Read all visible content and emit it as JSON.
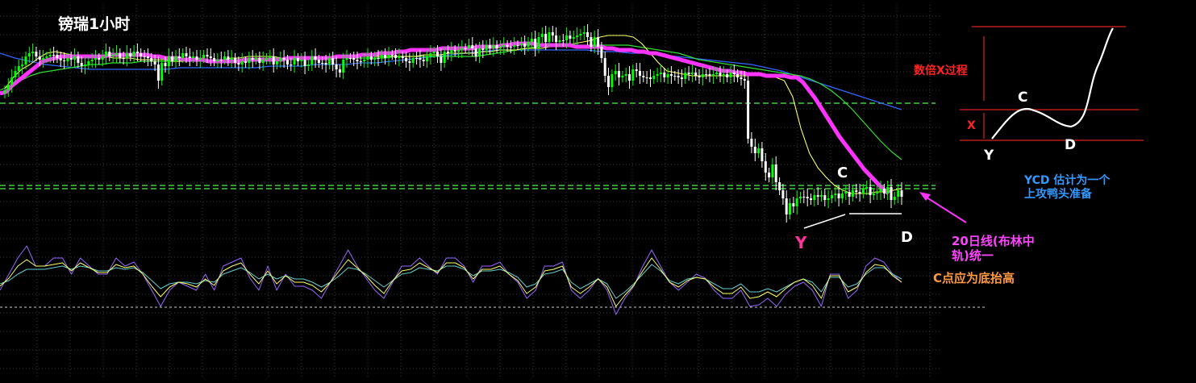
{
  "chart_data": {
    "type": "line",
    "title": "镑瑞1小时",
    "xlabel": "",
    "ylabel": "",
    "grid": true,
    "colors": {
      "background": "#000000",
      "bull": "#00ff00",
      "bear": "#ffffff",
      "ma_main": "#ff33ff",
      "ma_fast": "#ffff66",
      "ma_green": "#33dd33",
      "ma_blue": "#3366ff",
      "support": "#44cc44",
      "grid": "#4a4a4a",
      "osc_purple": "#9966ff",
      "osc_yellow": "#ffff66",
      "osc_cyan": "#66cccc"
    },
    "price": {
      "closes": [
        112,
        105,
        96,
        88,
        82,
        80,
        70,
        66,
        64,
        70,
        74,
        72,
        70,
        68,
        68,
        72,
        75,
        76,
        72,
        74,
        70,
        78,
        82,
        80,
        76,
        74,
        72,
        74,
        70,
        64,
        70,
        68,
        66,
        72,
        72,
        66,
        70,
        64,
        66,
        70,
        70,
        72,
        76,
        80,
        100,
        78,
        82,
        70,
        76,
        70,
        72,
        66,
        70,
        72,
        70,
        74,
        72,
        68,
        70,
        72,
        76,
        74,
        74,
        70,
        74,
        72,
        78,
        80,
        76,
        78,
        72,
        74,
        72,
        78,
        74,
        72,
        70,
        80,
        76,
        72,
        74,
        80,
        80,
        72,
        76,
        74,
        82,
        80,
        70,
        74,
        78,
        78,
        80,
        72,
        80,
        86,
        90,
        74,
        72,
        72,
        74,
        76,
        76,
        74,
        70,
        74,
        72,
        72,
        68,
        72,
        68,
        68,
        72,
        70,
        72,
        76,
        78,
        72,
        72,
        74,
        76,
        70,
        66,
        64,
        70,
        78,
        64,
        66,
        62,
        64,
        62,
        60,
        60,
        56,
        60,
        70,
        60,
        62,
        56,
        60,
        56,
        60,
        58,
        56,
        58,
        58,
        56,
        56,
        54,
        58,
        52,
        48,
        60,
        46,
        42,
        52,
        40,
        44,
        52,
        50,
        50,
        44,
        48,
        46,
        44,
        42,
        40,
        46,
        58,
        46,
        58,
        72,
        94,
        108,
        92,
        88,
        96,
        94,
        92,
        100,
        86,
        88,
        94,
        96,
        96,
        98,
        94,
        92,
        90,
        96,
        92,
        94,
        94,
        96,
        98,
        90,
        92,
        90,
        94,
        96,
        92,
        92,
        94,
        92,
        90,
        94,
        92,
        96,
        90,
        92,
        96,
        98,
        100,
        172,
        182,
        190,
        184,
        200,
        214,
        220,
        204,
        226,
        236,
        246,
        266,
        252,
        256,
        246,
        244,
        244,
        246,
        248,
        242,
        244,
        242,
        248,
        246,
        242,
        240,
        246,
        240,
        238,
        244,
        236,
        238,
        240,
        234,
        232,
        242,
        240,
        238,
        234,
        240,
        232,
        248,
        244,
        236,
        244
      ],
      "wick_range": 6,
      "ma_main": [
        116,
        114,
        106,
        100,
        94,
        88,
        82,
        76,
        74,
        72,
        70,
        70,
        70,
        70,
        70,
        70,
        70,
        70,
        68,
        68,
        68,
        68,
        68,
        68,
        68,
        70,
        70,
        72,
        72,
        72,
        74,
        74,
        74,
        74,
        76,
        76,
        76,
        76,
        76,
        76,
        74,
        74,
        74,
        74,
        74,
        74,
        74,
        72,
        72,
        72,
        72,
        72,
        72,
        72,
        72,
        70,
        70,
        70,
        70,
        68,
        68,
        68,
        66,
        66,
        66,
        64,
        64,
        62,
        62,
        62,
        62,
        62,
        60,
        60,
        60,
        60,
        60,
        60,
        58,
        58,
        58,
        58,
        56,
        56,
        54,
        54,
        54,
        54,
        56,
        56,
        56,
        56,
        56,
        56,
        58,
        58,
        58,
        58,
        58,
        60,
        60,
        62,
        62,
        62,
        64,
        64,
        66,
        66,
        68,
        70,
        72,
        74,
        76,
        78,
        80,
        82,
        84,
        86,
        88,
        88,
        90,
        90,
        92,
        92,
        92,
        94,
        94,
        94,
        94,
        96,
        96,
        102,
        112,
        122,
        134,
        146,
        158,
        170,
        180,
        190,
        200,
        210,
        218,
        226,
        234,
        240
      ],
      "ma_fast": [
        110,
        96,
        86,
        80,
        72,
        66,
        64,
        66,
        68,
        68,
        70,
        70,
        70,
        72,
        72,
        72,
        74,
        74,
        74,
        74,
        76,
        76,
        76,
        76,
        76,
        74,
        74,
        72,
        72,
        70,
        70,
        70,
        70,
        72,
        72,
        74,
        72,
        72,
        72,
        72,
        72,
        70,
        70,
        70,
        70,
        70,
        70,
        70,
        70,
        70,
        68,
        68,
        68,
        66,
        66,
        66,
        66,
        64,
        64,
        62,
        62,
        62,
        60,
        60,
        60,
        58,
        58,
        56,
        54,
        52,
        50,
        46,
        44,
        44,
        44,
        46,
        54,
        66,
        78,
        88,
        90,
        92,
        94,
        94,
        94,
        94,
        94,
        94,
        94,
        94,
        94,
        94,
        96,
        100,
        120,
        160,
        190,
        208,
        220,
        230,
        236,
        240,
        240,
        240,
        238,
        238,
        236,
        234
      ],
      "ma_green": [
        112,
        106,
        100,
        94,
        90,
        88,
        86,
        84,
        82,
        80,
        80,
        78,
        78,
        78,
        76,
        76,
        76,
        76,
        76,
        76,
        76,
        76,
        76,
        76,
        74,
        74,
        74,
        74,
        74,
        72,
        72,
        72,
        72,
        72,
        72,
        72,
        72,
        72,
        72,
        70,
        70,
        70,
        70,
        70,
        70,
        70,
        70,
        70,
        68,
        66,
        64,
        62,
        60,
        58,
        56,
        56,
        56,
        56,
        56,
        56,
        56,
        56,
        56,
        58,
        60,
        62,
        64,
        66,
        70,
        74,
        76,
        78,
        80,
        82,
        84,
        86,
        88,
        90,
        92,
        94,
        98,
        104,
        112,
        122,
        134,
        148,
        162,
        176,
        188,
        198
      ],
      "ma_blue": [
        66,
        72,
        76,
        80,
        82,
        84,
        86,
        86,
        86,
        86,
        86,
        86,
        84,
        84,
        84,
        84,
        84,
        84,
        82,
        82,
        82,
        80,
        80,
        80,
        78,
        78,
        76,
        74,
        72,
        70,
        68,
        66,
        64,
        62,
        62,
        62,
        62,
        62,
        62,
        62,
        64,
        64,
        66,
        66,
        68,
        70,
        72,
        74,
        76,
        78,
        80,
        84,
        88,
        94,
        100,
        106,
        112,
        118,
        124,
        130,
        136
      ]
    },
    "support_levels": [
      128,
      230,
      234
    ],
    "oscillator": {
      "purple": [
        360,
        340,
        320,
        305,
        330,
        330,
        320,
        320,
        340,
        320,
        330,
        340,
        340,
        320,
        330,
        325,
        340,
        360,
        380,
        360,
        350,
        355,
        360,
        340,
        360,
        330,
        325,
        320,
        345,
        360,
        330,
        360,
        340,
        355,
        355,
        360,
        370,
        350,
        330,
        310,
        330,
        345,
        360,
        370,
        350,
        330,
        330,
        320,
        330,
        340,
        320,
        320,
        330,
        350,
        330,
        330,
        325,
        340,
        350,
        370,
        360,
        330,
        330,
        325,
        360,
        370,
        360,
        345,
        360,
        390,
        370,
        355,
        330,
        310,
        330,
        350,
        360,
        350,
        340,
        345,
        360,
        370,
        370,
        360,
        380,
        378,
        370,
        380,
        365,
        355,
        350,
        360,
        380,
        340,
        340,
        370,
        360,
        330,
        320,
        325,
        340,
        350
      ],
      "yellow": [
        355,
        345,
        330,
        322,
        330,
        330,
        328,
        326,
        336,
        326,
        332,
        338,
        338,
        328,
        332,
        330,
        340,
        355,
        368,
        356,
        350,
        352,
        356,
        346,
        354,
        336,
        330,
        326,
        340,
        352,
        336,
        352,
        342,
        350,
        350,
        354,
        362,
        350,
        336,
        322,
        332,
        342,
        354,
        364,
        348,
        336,
        334,
        326,
        332,
        338,
        326,
        326,
        332,
        346,
        334,
        334,
        330,
        340,
        348,
        364,
        356,
        336,
        334,
        330,
        356,
        364,
        356,
        346,
        356,
        380,
        366,
        354,
        336,
        320,
        334,
        350,
        356,
        348,
        344,
        346,
        356,
        364,
        364,
        356,
        370,
        368,
        362,
        368,
        358,
        350,
        346,
        354,
        370,
        342,
        342,
        362,
        356,
        338,
        328,
        330,
        342,
        350
      ],
      "cyan": [
        352,
        348,
        340,
        334,
        334,
        334,
        332,
        330,
        334,
        330,
        332,
        336,
        336,
        332,
        334,
        332,
        338,
        348,
        358,
        352,
        350,
        350,
        352,
        348,
        350,
        340,
        336,
        332,
        338,
        346,
        340,
        346,
        342,
        346,
        346,
        350,
        356,
        350,
        342,
        332,
        334,
        340,
        348,
        356,
        348,
        340,
        338,
        332,
        334,
        336,
        330,
        330,
        334,
        342,
        336,
        336,
        334,
        338,
        344,
        356,
        352,
        340,
        338,
        334,
        350,
        358,
        352,
        346,
        352,
        370,
        362,
        352,
        340,
        328,
        336,
        348,
        352,
        346,
        344,
        346,
        352,
        358,
        358,
        352,
        362,
        362,
        358,
        362,
        356,
        350,
        346,
        350,
        362,
        344,
        344,
        356,
        352,
        340,
        332,
        332,
        340,
        346
      ],
      "baseline": 381
    },
    "annotations": {
      "c_main": "C",
      "y_main": "Y",
      "d_main": "D",
      "inset_c": "C",
      "inset_x": "X",
      "inset_y": "Y",
      "inset_d": "D",
      "multiple_label": "数倍X过程",
      "ycd_note_line1": "YCD 估计为一个",
      "ycd_note_line2": "上攻鸭头准备",
      "ma20_note_line1": "20日线(布林中",
      "ma20_note_line2": "轨)统一",
      "c_point_note": "C点应为底抬高"
    }
  }
}
